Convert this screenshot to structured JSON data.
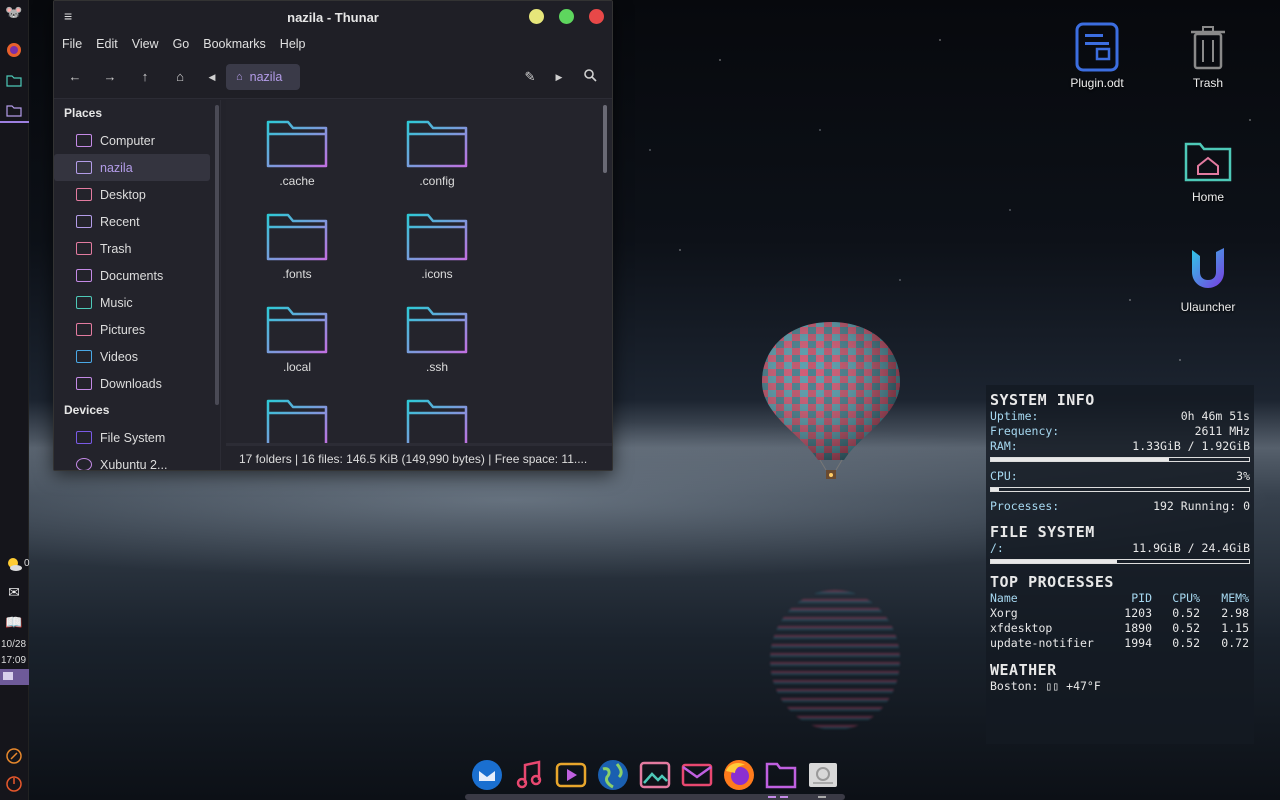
{
  "window": {
    "title": "nazila - Thunar",
    "menu": [
      "File",
      "Edit",
      "View",
      "Go",
      "Bookmarks",
      "Help"
    ],
    "path": "nazila",
    "places_header": "Places",
    "places": [
      {
        "label": "Computer",
        "icon": "computer-icon",
        "color": "#c48ae6"
      },
      {
        "label": "nazila",
        "icon": "home-icon",
        "color": "#b39ce8",
        "active": true
      },
      {
        "label": "Desktop",
        "icon": "desktop-folder-icon",
        "color": "#e37ba0"
      },
      {
        "label": "Recent",
        "icon": "recent-icon",
        "color": "#b39ce8"
      },
      {
        "label": "Trash",
        "icon": "trash-icon",
        "color": "#e37ba0"
      },
      {
        "label": "Documents",
        "icon": "documents-folder-icon",
        "color": "#c48ae6"
      },
      {
        "label": "Music",
        "icon": "music-folder-icon",
        "color": "#4ec9b8"
      },
      {
        "label": "Pictures",
        "icon": "pictures-folder-icon",
        "color": "#e37ba0"
      },
      {
        "label": "Videos",
        "icon": "videos-folder-icon",
        "color": "#4aa8e6"
      },
      {
        "label": "Downloads",
        "icon": "downloads-folder-icon",
        "color": "#c48ae6"
      }
    ],
    "devices_header": "Devices",
    "devices": [
      {
        "label": "File System",
        "icon": "filesystem-icon"
      },
      {
        "label": "Xubuntu 2...",
        "icon": "disc-icon"
      }
    ],
    "files": [
      ".cache",
      ".config",
      ".fonts",
      ".icons",
      ".local",
      ".ssh",
      "",
      ""
    ],
    "status": "17 folders  |  16 files: 146.5 KiB (149,990 bytes)  |  Free space: 11...."
  },
  "desktop_icons": [
    {
      "label": "Plugin.odt",
      "icon": "document-icon"
    },
    {
      "label": "Trash",
      "icon": "trash-icon"
    },
    {
      "label": "Home",
      "icon": "home-folder-icon"
    },
    {
      "label": "Ulauncher",
      "icon": "ulauncher-icon"
    }
  ],
  "panel": {
    "date": "10/28",
    "time": "17:09",
    "weather_value": "0"
  },
  "conky": {
    "system_info": "SYSTEM INFO",
    "uptime_label": "Uptime:",
    "uptime": "0h 46m 51s",
    "freq_label": "Frequency:",
    "freq": "2611 MHz",
    "ram_label": "RAM:",
    "ram": "1.33GiB / 1.92GiB",
    "ram_fraction": 0.69,
    "cpu_label": "CPU:",
    "cpu": "3%",
    "cpu_fraction": 0.03,
    "proc_label": "Processes:",
    "proc": "192 Running: 0",
    "file_system": "FILE SYSTEM",
    "fs_label": "/:",
    "fs": "11.9GiB / 24.4GiB",
    "fs_fraction": 0.49,
    "top_processes": "TOP PROCESSES",
    "tp_headers": [
      "Name",
      "PID",
      "CPU%",
      "MEM%"
    ],
    "tp_rows": [
      [
        "Xorg",
        "1203",
        "0.52",
        "2.98"
      ],
      [
        "xfdesktop",
        "1890",
        "0.52",
        "1.15"
      ],
      [
        "update-notifier",
        "1994",
        "0.52",
        "0.72"
      ]
    ],
    "weather": "WEATHER",
    "weather_line": "Boston: ▯▯  +47°F"
  },
  "dock": [
    "thunderbird-icon",
    "music-icon",
    "video-player-icon",
    "globe-icon",
    "image-viewer-icon",
    "mail-icon",
    "firefox-icon",
    "folder-icon",
    "disk-icon"
  ],
  "colors": {
    "accent": "#b39ce8",
    "folder_cyan": "#2ec9d6",
    "folder_pink": "#c070e0"
  }
}
